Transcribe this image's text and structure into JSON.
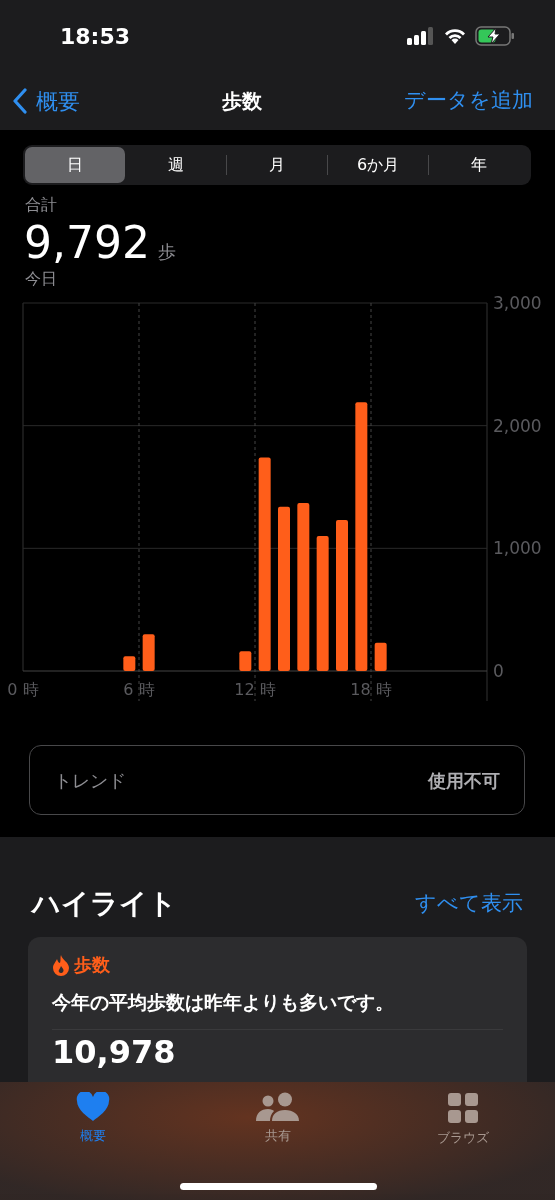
{
  "status_bar": {
    "time": "18:53"
  },
  "nav": {
    "back": "概要",
    "title": "歩数",
    "action": "データを追加"
  },
  "segments": [
    {
      "label": "日",
      "selected": true
    },
    {
      "label": "週",
      "selected": false
    },
    {
      "label": "月",
      "selected": false
    },
    {
      "label": "6か月",
      "selected": false
    },
    {
      "label": "年",
      "selected": false
    }
  ],
  "summary": {
    "label": "合計",
    "value": "9,792",
    "unit": "歩",
    "date": "今日"
  },
  "chart_data": {
    "type": "bar",
    "x": [
      0.5,
      1.5,
      2.5,
      3.5,
      4.5,
      5.5,
      6.5,
      7.5,
      8.5,
      9.5,
      10.5,
      11.5,
      12.5,
      13.5,
      14.5,
      15.5,
      16.5,
      17.5,
      18.5,
      19.5,
      20.5,
      21.5,
      22.5,
      23.5
    ],
    "series": [
      {
        "color": "#ff5e1a",
        "values": [
          0,
          0,
          0,
          0,
          0,
          120,
          300,
          0,
          0,
          0,
          0,
          160,
          1740,
          1340,
          1370,
          1100,
          1230,
          2190,
          230,
          0,
          0,
          0,
          0,
          0
        ]
      }
    ],
    "xlim": [
      0,
      24
    ],
    "grid": true,
    "xticks": [
      {
        "value": 0,
        "label": "0 時"
      },
      {
        "value": 6,
        "label": "6 時"
      },
      {
        "value": 12,
        "label": "12 時"
      },
      {
        "value": 18,
        "label": "18 時"
      }
    ],
    "ylim": [
      0,
      3000
    ],
    "yticks": [
      {
        "value": 0,
        "label": "0"
      },
      {
        "value": 1000,
        "label": "1,000"
      },
      {
        "value": 2000,
        "label": "2,000"
      },
      {
        "value": 3000,
        "label": "3,000"
      }
    ]
  },
  "trend": {
    "label": "トレンド",
    "value": "使用不可"
  },
  "highlights": {
    "title": "ハイライト",
    "link": "すべて表示",
    "card": {
      "category": "歩数",
      "text": "今年の平均歩数は昨年よりも多いです。",
      "value": "10,978"
    }
  },
  "tab_bar": [
    {
      "kind": "heart",
      "label": "概要",
      "selected": true
    },
    {
      "kind": "people",
      "label": "共有",
      "selected": false
    },
    {
      "kind": "grid",
      "label": "ブラウズ",
      "selected": false
    }
  ]
}
